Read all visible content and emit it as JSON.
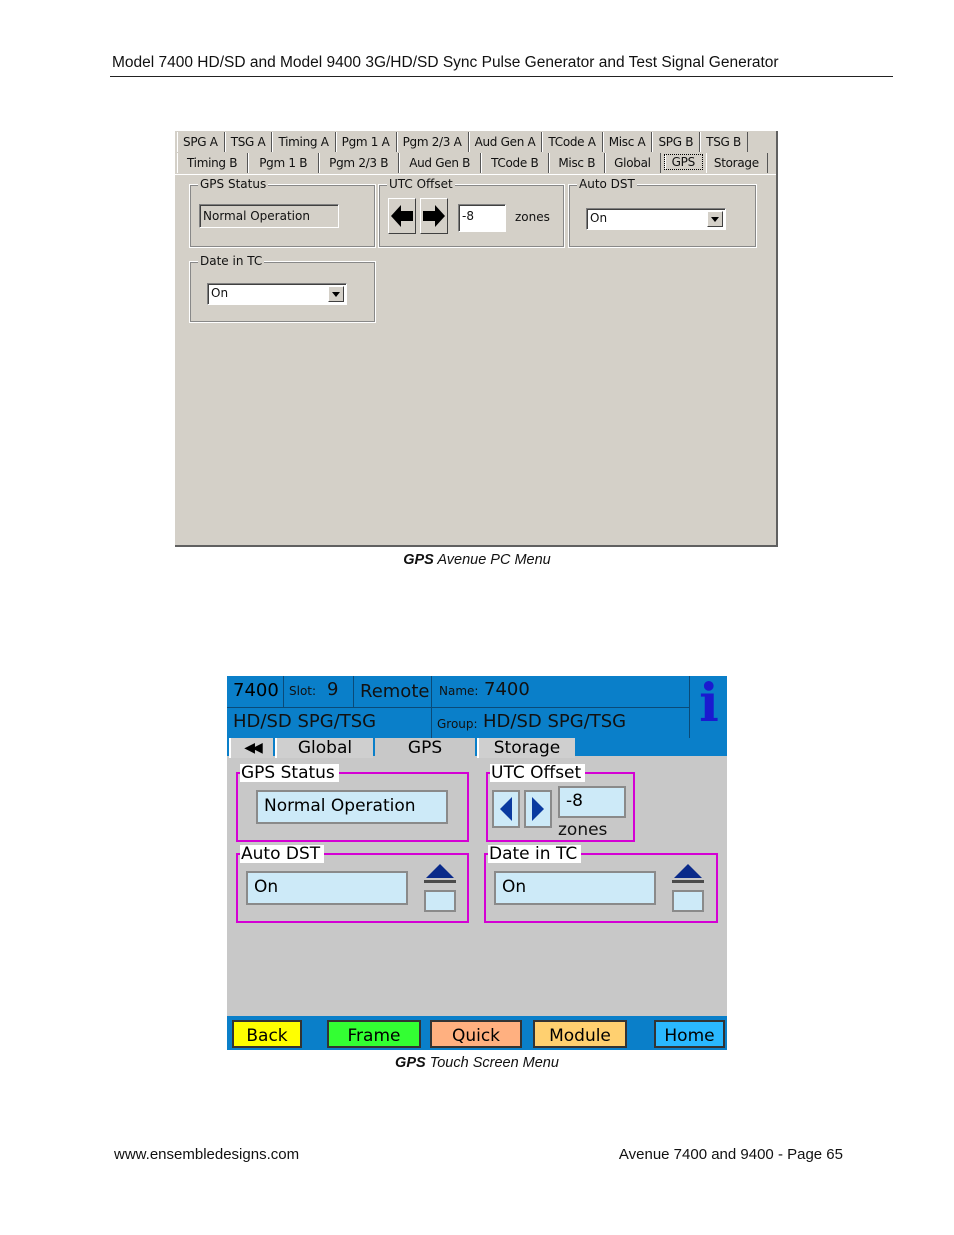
{
  "header": "Model 7400 HD/SD and Model 9400 3G/HD/SD Sync Pulse Generator and Test Signal Generator",
  "pc_menu": {
    "tabs_row1": [
      "SPG A",
      "TSG A",
      "Timing A",
      "Pgm 1 A",
      "Pgm 2/3 A",
      "Aud Gen A",
      "TCode A",
      "Misc A",
      "SPG B",
      "TSG B"
    ],
    "tabs_row2": [
      "Timing B",
      "Pgm 1 B",
      "Pgm 2/3 B",
      "Aud Gen B",
      "TCode B",
      "Misc B",
      "Global",
      "GPS",
      "Storage"
    ],
    "selected_tab": "GPS",
    "gps_status": {
      "label": "GPS Status",
      "value": "Normal Operation"
    },
    "utc_offset": {
      "label": "UTC Offset",
      "value": "-8",
      "unit": "zones"
    },
    "auto_dst": {
      "label": "Auto DST",
      "value": "On"
    },
    "date_in_tc": {
      "label": "Date in TC",
      "value": "On"
    }
  },
  "caption1": {
    "bold": "GPS",
    "rest": " Avenue PC Menu"
  },
  "touch_menu": {
    "model": "7400",
    "slot_label": "Slot:",
    "slot_value": "9",
    "mode": "Remote",
    "name_label": "Name:",
    "name_value": "7400",
    "device": "HD/SD SPG/TSG",
    "group_label": "Group:",
    "group_value": "HD/SD SPG/TSG",
    "info_icon": "i",
    "nav_arrows": "◀◀",
    "tabs": [
      "Global",
      "GPS",
      "Storage"
    ],
    "gps_status": {
      "label": "GPS Status",
      "value": "Normal Operation"
    },
    "utc_offset": {
      "label": "UTC Offset",
      "value": "-8",
      "unit": "zones"
    },
    "auto_dst": {
      "label": "Auto DST",
      "value": "On"
    },
    "date_in_tc": {
      "label": "Date in TC",
      "value": "On"
    },
    "buttons": [
      "Back",
      "Frame",
      "Quick",
      "Module",
      "Home"
    ],
    "button_colors": [
      "#ffff00",
      "#33ff33",
      "#ffb080",
      "#ffd070",
      "#2ab8ff"
    ]
  },
  "caption2": {
    "bold": "GPS",
    "rest": " Touch Screen Menu"
  },
  "footer": {
    "left": "www.ensembledesigns.com",
    "right": "Avenue 7400 and 9400 - Page 65"
  }
}
